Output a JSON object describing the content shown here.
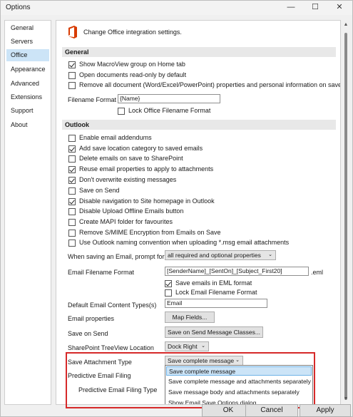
{
  "window": {
    "title": "Options"
  },
  "sidebar": {
    "items": [
      {
        "label": "General"
      },
      {
        "label": "Servers"
      },
      {
        "label": "Office"
      },
      {
        "label": "Appearance"
      },
      {
        "label": "Advanced"
      },
      {
        "label": "Extensions"
      },
      {
        "label": "Support"
      },
      {
        "label": "About"
      }
    ],
    "selected": "Office"
  },
  "header": {
    "text": "Change Office integration settings."
  },
  "general": {
    "title": "General",
    "checks": [
      {
        "label": "Show MacroView group on Home tab",
        "checked": true
      },
      {
        "label": "Open documents read-only by default",
        "checked": false
      },
      {
        "label": "Remove all document (Word/Excel/PowerPoint) properties and personal information on save",
        "checked": false
      }
    ],
    "filename_format_label": "Filename Format",
    "filename_format_value": "{Name}",
    "lock_filename_label": "Lock Office Filename Format",
    "lock_filename_checked": false
  },
  "outlook": {
    "title": "Outlook",
    "checks": [
      {
        "label": "Enable email addendums",
        "checked": false
      },
      {
        "label": "Add save location category to saved emails",
        "checked": true
      },
      {
        "label": "Delete emails on save to SharePoint",
        "checked": false
      },
      {
        "label": "Reuse email properties to apply to attachments",
        "checked": true
      },
      {
        "label": "Don't overwrite existing messages",
        "checked": true
      },
      {
        "label": "Save on Send",
        "checked": false
      },
      {
        "label": "Disable navigation to Site homepage in Outlook",
        "checked": true
      },
      {
        "label": "Disable Upload Offline Emails button",
        "checked": false
      },
      {
        "label": "Create MAPI folder for favourites",
        "checked": false
      },
      {
        "label": "Remove S/MIME Encryption from Emails on Save",
        "checked": false
      },
      {
        "label": "Use Outlook naming convention when uploading *.msg email attachments",
        "checked": false
      }
    ],
    "prompt_label": "When saving an Email, prompt for",
    "prompt_value": "all required and optional properties",
    "email_filename_label": "Email Filename Format",
    "email_filename_value": "[SenderName]_[SentOn]_[Subject_First20]",
    "email_ext": ".eml",
    "save_eml_label": "Save emails in EML format",
    "save_eml_checked": true,
    "lock_email_label": "Lock Email Filename Format",
    "lock_email_checked": false,
    "default_ct_label": "Default Email Content Types(s)",
    "default_ct_value": "Email",
    "email_props_label": "Email properties",
    "map_fields_button": "Map Fields...",
    "save_on_send_label": "Save on Send",
    "save_on_send_button": "Save on Send Message Classes...",
    "treeview_label": "SharePoint TreeView Location",
    "treeview_value": "Dock Right",
    "attach_type_label": "Save Attachment Type",
    "attach_type_value": "Save complete message",
    "predictive_label": "Predictive Email Filing",
    "predictive_type_label": "Predictive Email Filing Type",
    "attach_options": [
      "Save complete message",
      "Save complete message and attachments separately",
      "Save message body and attachments separately",
      "Show Email Save Options dialog"
    ],
    "attach_selected_index": 0
  },
  "footer": {
    "ok": "OK",
    "cancel": "Cancel",
    "apply": "Apply"
  },
  "colors": {
    "accent_selection": "#cce4f7",
    "highlight_border": "#d62929",
    "office_logo": "#d83b01"
  }
}
